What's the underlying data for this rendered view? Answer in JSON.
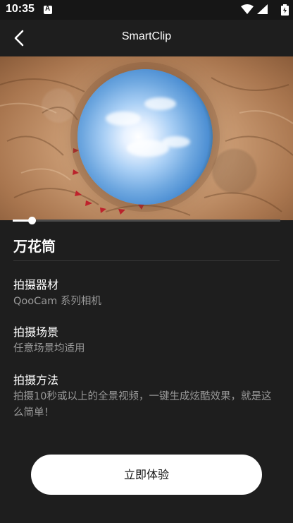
{
  "status_bar": {
    "time": "10:35",
    "notification_icon": "app-notification-icon",
    "icons": [
      "wifi-icon",
      "signal-icon",
      "battery-icon"
    ]
  },
  "header": {
    "title": "SmartClip",
    "back_icon": "chevron-left-icon"
  },
  "preview": {
    "description_icon": "tiny-planet-preview-image",
    "progress": 0.07
  },
  "effect": {
    "name": "万花筒"
  },
  "sections": [
    {
      "title": "拍摄器材",
      "text": "QooCam 系列相机"
    },
    {
      "title": "拍摄场景",
      "text": "任意场景均适用"
    },
    {
      "title": "拍摄方法",
      "text": "拍摄10秒或以上的全景视频，一键生成炫酷效果，就是这么简单！"
    }
  ],
  "actions": {
    "try_now_label": "立即体验"
  },
  "colors": {
    "background": "#1e1e1e",
    "button_bg": "#ffffff",
    "secondary_text": "#9a9a9a"
  }
}
